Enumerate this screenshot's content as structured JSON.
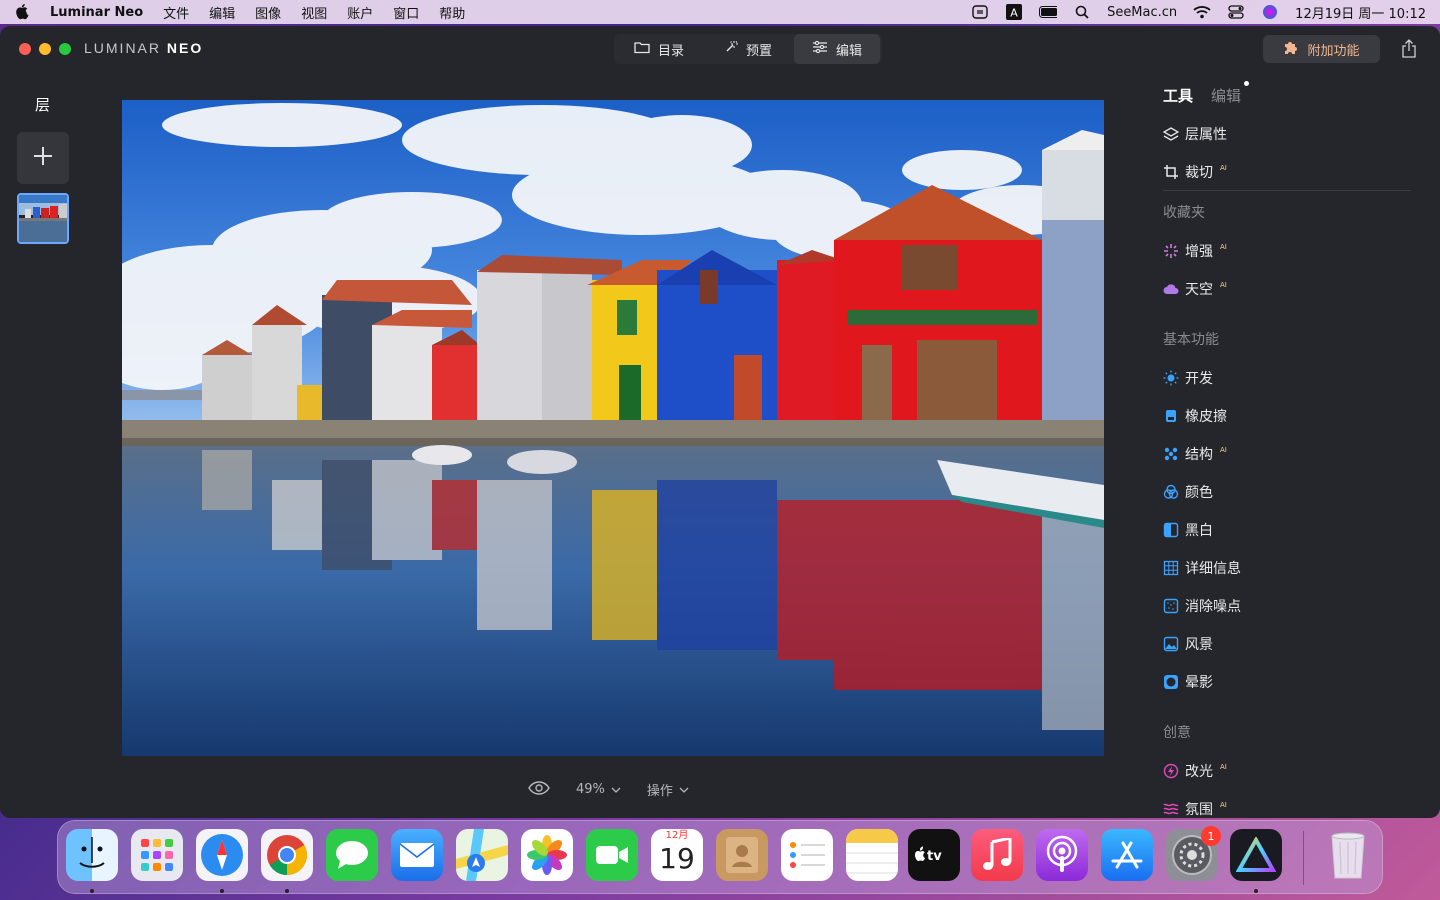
{
  "menubar": {
    "app_name": "Luminar Neo",
    "items": [
      "文件",
      "编辑",
      "图像",
      "视图",
      "账户",
      "窗口",
      "帮助"
    ],
    "site": "SeeMac.cn",
    "datetime": "12月19日 周一  10:12"
  },
  "titlebar": {
    "logo_part1": "LUMINAR ",
    "logo_part2": "NEO",
    "modes": [
      "目录",
      "预置",
      "编辑"
    ],
    "active_mode": "编辑",
    "addon_label": "附加功能"
  },
  "layers": {
    "title": "层"
  },
  "bottom_bar": {
    "zoom": "49%",
    "actions_label": "操作"
  },
  "right_panel": {
    "tab_tools": "工具",
    "tab_edits": "编辑",
    "top_tools": [
      {
        "label": "层属性",
        "icon": "layers-icon",
        "ai": ""
      },
      {
        "label": "裁切",
        "icon": "crop-icon",
        "ai": "AI"
      }
    ],
    "favorites_title": "收藏夹",
    "favorites": [
      {
        "label": "增强",
        "icon": "enhance-icon",
        "ai": "AI"
      },
      {
        "label": "天空",
        "icon": "sky-icon",
        "ai": "AI"
      }
    ],
    "essentials_title": "基本功能",
    "essentials": [
      {
        "label": "开发",
        "icon": "develop-icon",
        "ai": ""
      },
      {
        "label": "橡皮擦",
        "icon": "eraser-icon",
        "ai": ""
      },
      {
        "label": "结构",
        "icon": "structure-icon",
        "ai": "AI"
      },
      {
        "label": "颜色",
        "icon": "color-icon",
        "ai": ""
      },
      {
        "label": "黑白",
        "icon": "bw-icon",
        "ai": ""
      },
      {
        "label": "详细信息",
        "icon": "details-icon",
        "ai": ""
      },
      {
        "label": "消除噪点",
        "icon": "denoise-icon",
        "ai": ""
      },
      {
        "label": "风景",
        "icon": "landscape-icon",
        "ai": ""
      },
      {
        "label": "晕影",
        "icon": "vignette-icon",
        "ai": ""
      }
    ],
    "creative_title": "创意",
    "creative": [
      {
        "label": "改光",
        "icon": "relight-icon",
        "ai": "AI"
      },
      {
        "label": "氛围",
        "icon": "atmosphere-icon",
        "ai": "AI"
      }
    ]
  },
  "dock": {
    "calendar_month": "12月",
    "calendar_day": "19",
    "settings_badge": "1"
  },
  "colors": {
    "accent_blue": "#6da7ff",
    "addon_orange": "#f1b68e",
    "ai_badge": "#ffd27a"
  }
}
